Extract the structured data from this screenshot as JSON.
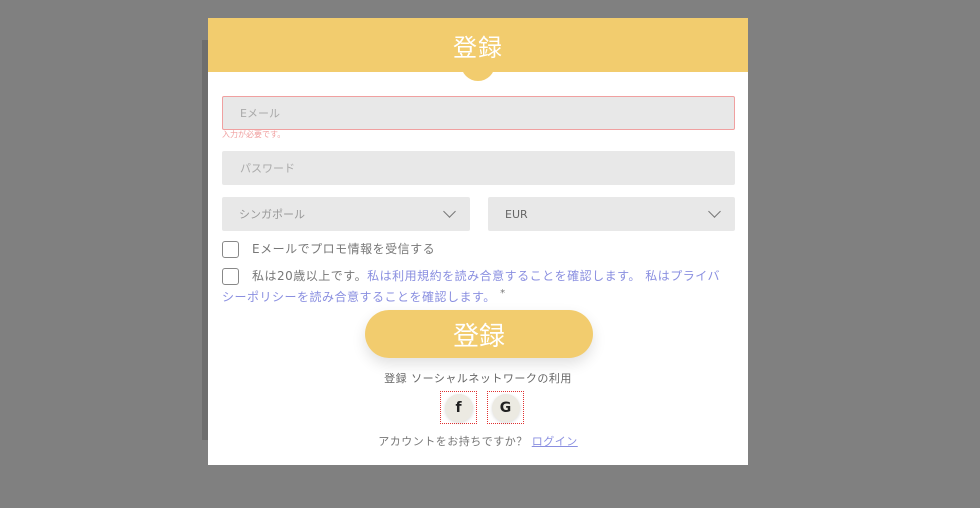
{
  "modal": {
    "title": "登録",
    "email_placeholder": "Eメール",
    "email_error": "入力が必要です。",
    "password_placeholder": "パスワード",
    "country": "シンガポール",
    "currency": "EUR",
    "promo_label": "Eメールでプロモ情報を受信する",
    "terms": {
      "part1": "私は20歳以上です。",
      "link1": "私は利用規約を読み合意することを確認します。",
      "link2": "私はプライバシーポリシーを読み合意することを確認します。",
      "required_mark": "*"
    },
    "submit_label": "登録",
    "social_caption": "登録 ソーシャルネットワークの利用",
    "social": {
      "facebook_glyph": "f",
      "google_glyph": "G"
    },
    "login_prompt": "アカウントをお持ちですか？",
    "login_link": "ログイン"
  },
  "colors": {
    "accent": "#f2cc6e",
    "link": "#8a8fe0",
    "error": "#f0a0a0",
    "overlay": "#808080"
  }
}
